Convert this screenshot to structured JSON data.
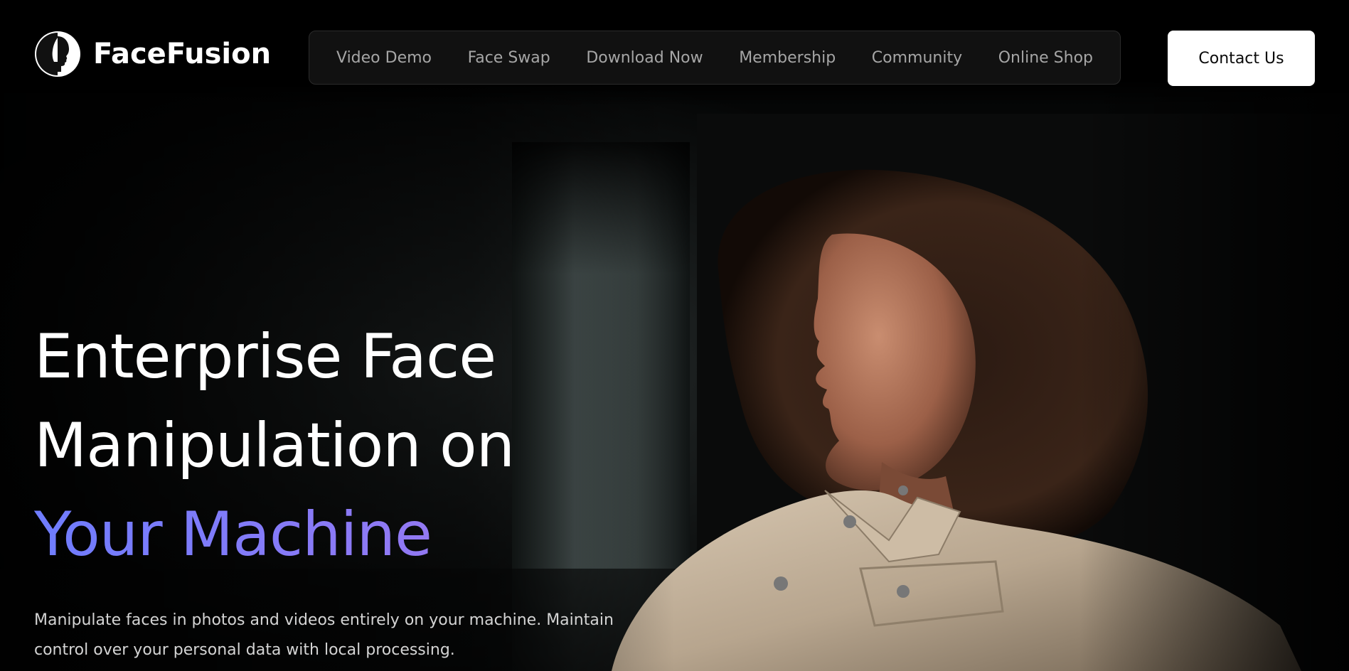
{
  "brand": {
    "name": "FaceFusion"
  },
  "nav": {
    "items": [
      {
        "label": "Video Demo"
      },
      {
        "label": "Face Swap"
      },
      {
        "label": "Download Now"
      },
      {
        "label": "Membership"
      },
      {
        "label": "Community"
      },
      {
        "label": "Online Shop"
      }
    ]
  },
  "header": {
    "contact_label": "Contact Us"
  },
  "hero": {
    "title_line1": "Enterprise Face",
    "title_line2": "Manipulation on",
    "title_line3": "Your Machine",
    "description": "Manipulate faces in photos and videos entirely on your machine. Maintain control over your personal data with local processing."
  },
  "colors": {
    "background": "#000000",
    "nav_text": "#a6a6a6",
    "nav_bg": "#111111",
    "accent_start": "#6f7dff",
    "accent_end": "#9a78f0",
    "button_bg": "#ffffff"
  },
  "icons": {
    "logo": "face-profile-logo-icon"
  }
}
